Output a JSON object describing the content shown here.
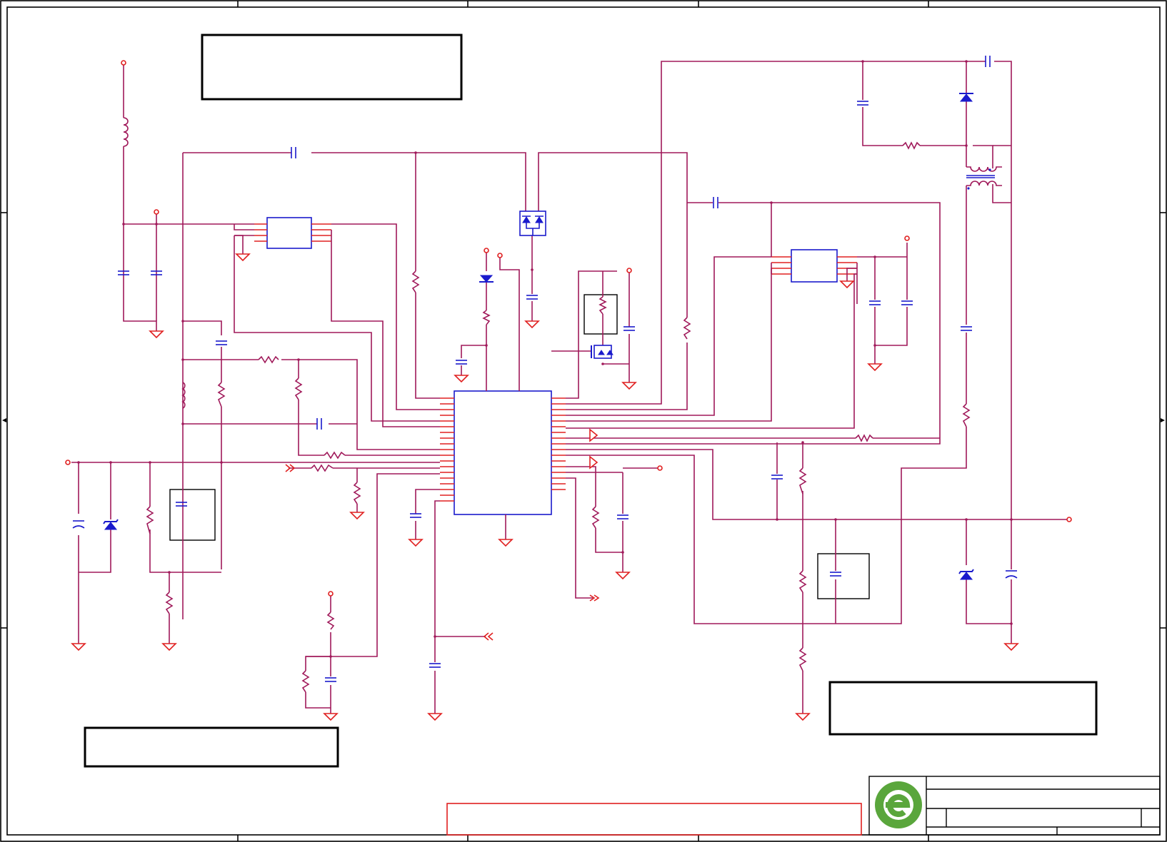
{
  "schematic": {
    "style": {
      "wire_color": "#a0195a",
      "component_color": "#1a1acc",
      "power_symbol_color": "#e02020",
      "frame_color": "#000000",
      "logo_color": "#5aa63c"
    },
    "main_ic": {
      "name": "main-controller-ic"
    },
    "notes": [
      {
        "name": "note-box-top"
      },
      {
        "name": "note-box-bottom-left"
      },
      {
        "name": "note-box-bottom-right"
      }
    ],
    "title_block": {
      "logo": "company-logo"
    }
  }
}
